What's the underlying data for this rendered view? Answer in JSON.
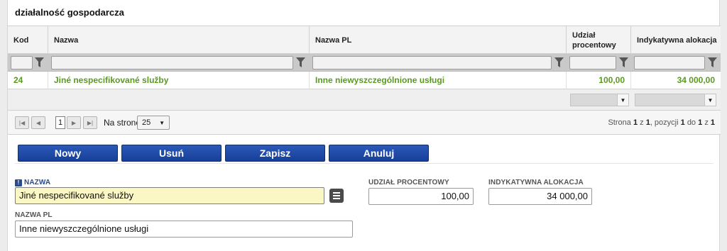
{
  "section": {
    "title": "działalność gospodarcza"
  },
  "table": {
    "columns": [
      "Kod",
      "Nazwa",
      "Nazwa PL",
      "Udział procentowy",
      "Indykatywna alokacja"
    ],
    "rows": [
      {
        "kod": "24",
        "nazwa": "Jiné nespecifikované služby",
        "nazwa_pl": "Inne niewyszczególnione usługi",
        "udzial": "100,00",
        "alokacja": "34 000,00"
      }
    ]
  },
  "pager": {
    "first": "|◀",
    "prev": "◀",
    "page": "1",
    "next": "▶",
    "last": "▶|",
    "per_page_label": "Na stronę",
    "per_page_value": "25",
    "info": {
      "strona_label": "Strona",
      "strona": "1",
      "z1": "z",
      "strona_total": "1",
      "pozycji_label": ", pozycji",
      "from": "1",
      "do": "do",
      "to": "1",
      "z2": "z",
      "total": "1"
    }
  },
  "actions": {
    "nowy": "Nowy",
    "usun": "Usuń",
    "zapisz": "Zapisz",
    "anuluj": "Anuluj"
  },
  "form": {
    "nazwa_label": "NAZWA",
    "nazwa_value": "Jiné nespecifikované služby",
    "nazwa_pl_label": "NAZWA PL",
    "nazwa_pl_value": "Inne niewyszczególnione usługi",
    "udzial_label": "UDZIAŁ PROCENTOWY",
    "udzial_value": "100,00",
    "alokacja_label": "INDYKATYWNA ALOKACJA",
    "alokacja_value": "34 000,00",
    "required_mark": "!"
  },
  "colors": {
    "accent_button": "#1f4aa8",
    "row_text": "#5a9a1f",
    "required_field_bg": "#fbf7c5"
  }
}
